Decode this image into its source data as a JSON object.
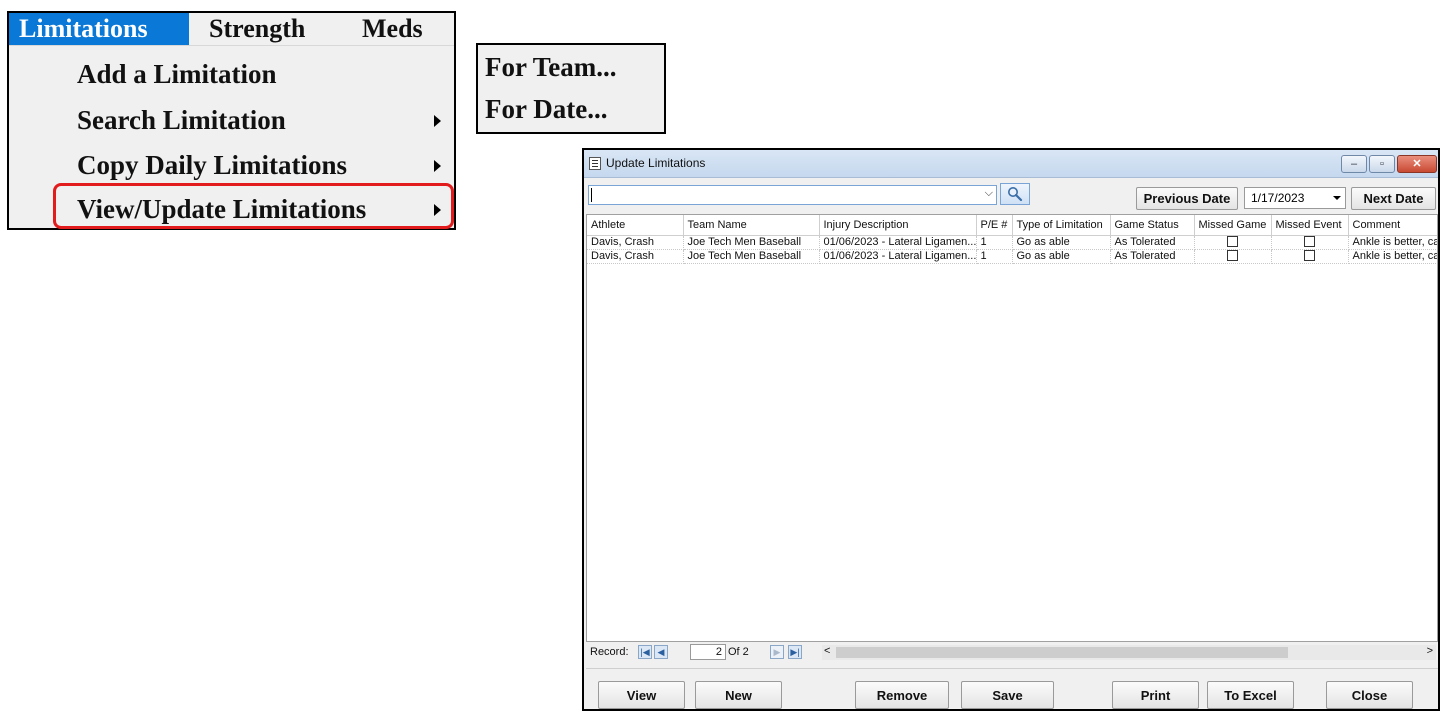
{
  "menu": {
    "bar": [
      "Limitations",
      "Strength",
      "Meds"
    ],
    "items": [
      {
        "label": "Add a Limitation",
        "submenu": false
      },
      {
        "label": "Search Limitation",
        "submenu": true
      },
      {
        "label": "Copy Daily Limitations",
        "submenu": true
      },
      {
        "label": "View/Update Limitations",
        "submenu": true
      }
    ],
    "highlight_color": "#e21c1c",
    "active_color": "#0a78d7"
  },
  "submenu": {
    "items": [
      "For Team...",
      "For Date..."
    ]
  },
  "window": {
    "title": "Update Limitations",
    "controls": [
      "minimize-icon",
      "maximize-icon",
      "close-icon"
    ],
    "search": {
      "value": ""
    },
    "previous_date_label": "Previous Date",
    "date_value": "1/17/2023",
    "next_date_label": "Next Date",
    "columns": [
      "Athlete",
      "Team Name",
      "Injury Description",
      "P/E #",
      "Type of Limitation",
      "Game Status",
      "Missed Game",
      "Missed Event",
      "Comment"
    ],
    "rows": [
      {
        "athlete": "Davis, Crash",
        "team": "Joe Tech Men Baseball",
        "injury": "01/06/2023 - Lateral Ligamen...",
        "pe": "1",
        "type": "Go as able",
        "status": "As Tolerated",
        "missed_game": false,
        "missed_event": false,
        "comment": "Ankle is better, ca"
      },
      {
        "athlete": "Davis, Crash",
        "team": "Joe Tech Men Baseball",
        "injury": "01/06/2023 - Lateral Ligamen...",
        "pe": "1",
        "type": "Go as able",
        "status": "As Tolerated",
        "missed_game": false,
        "missed_event": false,
        "comment": "Ankle is better, ca"
      }
    ],
    "navigator": {
      "label": "Record:",
      "current": "2",
      "of_text": "Of  2"
    },
    "buttons": {
      "view": "View",
      "new": "New",
      "remove": "Remove",
      "save": "Save",
      "print": "Print",
      "to_excel": "To Excel",
      "close": "Close"
    }
  }
}
